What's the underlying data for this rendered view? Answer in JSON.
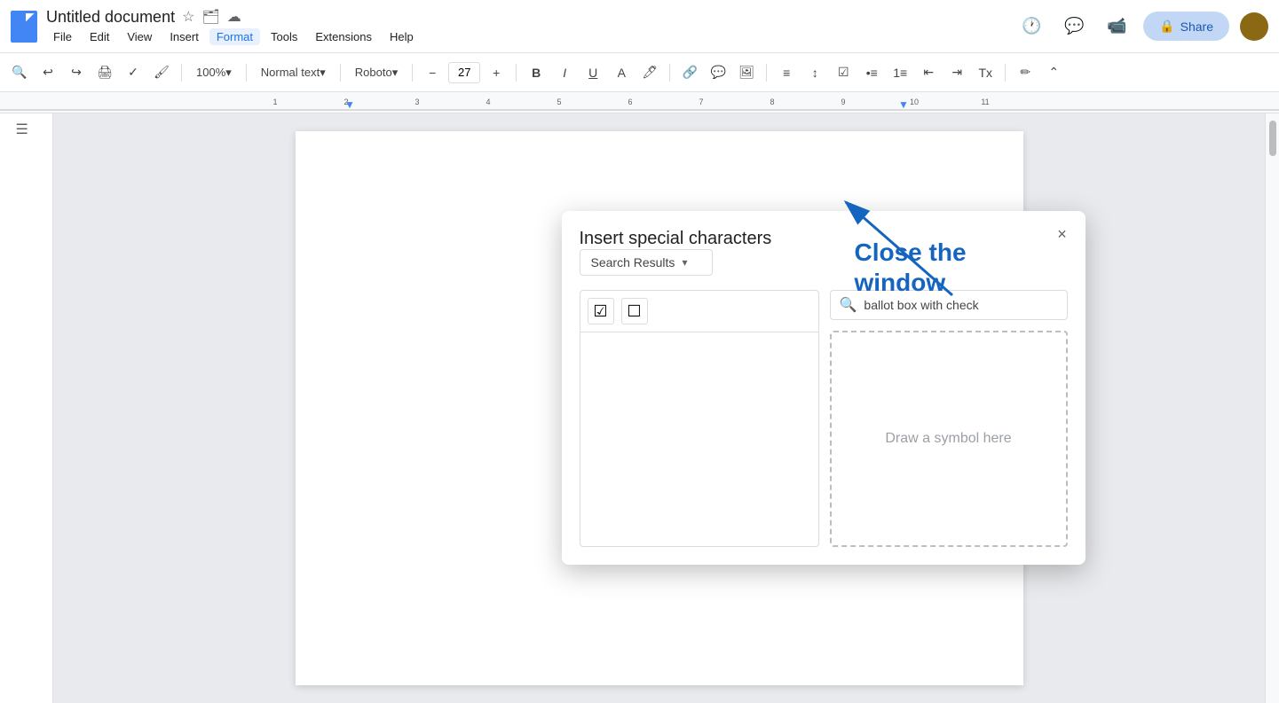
{
  "title": {
    "doc_name": "Untitled document",
    "star_icon": "★",
    "folder_icon": "📁",
    "cloud_icon": "☁"
  },
  "menu": {
    "items": [
      {
        "label": "File"
      },
      {
        "label": "Edit"
      },
      {
        "label": "View"
      },
      {
        "label": "Insert"
      },
      {
        "label": "Format"
      },
      {
        "label": "Tools"
      },
      {
        "label": "Extensions"
      },
      {
        "label": "Help"
      }
    ]
  },
  "toolbar": {
    "zoom": "100%",
    "style": "Normal text",
    "font": "Roboto",
    "font_size": "27",
    "share_label": "Share",
    "lock_icon": "🔒"
  },
  "dialog": {
    "title": "Insert special characters",
    "close_label": "×",
    "dropdown_label": "Search Results",
    "search_placeholder": "ballot box with check",
    "draw_placeholder": "Draw a symbol here",
    "symbols": [
      {
        "char": "☑",
        "label": "ballot box with check"
      },
      {
        "char": "☐",
        "label": "ballot box"
      }
    ]
  },
  "annotation": {
    "text_line1": "Close the",
    "text_line2": "window"
  }
}
